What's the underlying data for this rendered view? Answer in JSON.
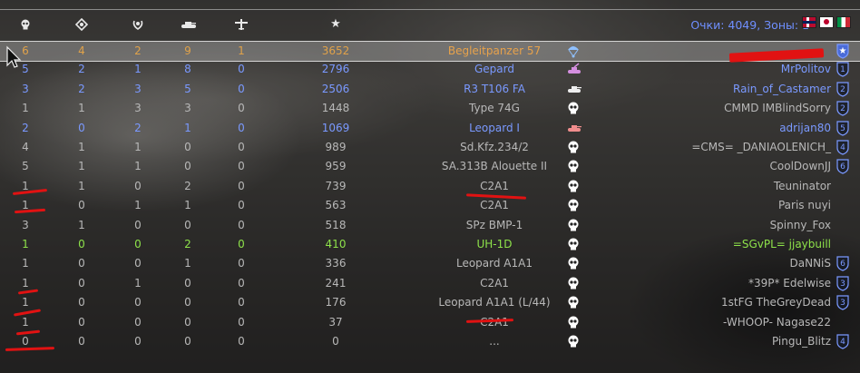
{
  "header": {
    "stats_text": "Очки: 4049, Зоны: 1",
    "column_icons": [
      "skull-icon",
      "target-icon",
      "assist-wreath-icon",
      "tank-icon",
      "plane-icon",
      "star-icon"
    ],
    "flags": [
      "norway-flag",
      "japan-flag",
      "italy-flag"
    ]
  },
  "colors": {
    "gold": "#e0a24a",
    "blue": "#7a99ff",
    "green": "#8ee24a",
    "grey": "#b8b8b8",
    "red_marker": "#e11212"
  },
  "rows": [
    {
      "c1": "6",
      "c2": "4",
      "c3": "2",
      "c4": "9",
      "c5": "1",
      "score": "3652",
      "vehicle": "Begleitpanzer 57",
      "vehicle_icon": "parachute-icon",
      "player": "",
      "squad": "star",
      "style": "gold",
      "highlight": true
    },
    {
      "c1": "5",
      "c2": "2",
      "c3": "1",
      "c4": "8",
      "c5": "0",
      "score": "2796",
      "vehicle": "Gepard",
      "vehicle_icon": "spaa-icon",
      "player": "MrPolitov",
      "squad": "1",
      "style": "blue"
    },
    {
      "c1": "3",
      "c2": "2",
      "c3": "3",
      "c4": "5",
      "c5": "0",
      "score": "2506",
      "vehicle": "R3 T106 FA",
      "vehicle_icon": "light-tank-icon",
      "player": "Rain_of_Castamer",
      "squad": "2",
      "style": "blue"
    },
    {
      "c1": "1",
      "c2": "1",
      "c3": "3",
      "c4": "3",
      "c5": "0",
      "score": "1448",
      "vehicle": "Type 74G",
      "vehicle_icon": "skull-icon",
      "player": "IMBlindSorry",
      "clan": "CMMD",
      "squad": "2",
      "style": "grey"
    },
    {
      "c1": "2",
      "c2": "0",
      "c3": "2",
      "c4": "1",
      "c5": "0",
      "score": "1069",
      "vehicle": "Leopard I",
      "vehicle_icon": "medium-tank-icon",
      "player": "adrijan80",
      "squad": "5",
      "style": "blue"
    },
    {
      "c1": "4",
      "c2": "1",
      "c3": "1",
      "c4": "0",
      "c5": "0",
      "score": "989",
      "vehicle": "Sd.Kfz.234/2",
      "vehicle_icon": "skull-icon",
      "player": "=CMS= _DANIAOLENICH_",
      "squad": "4",
      "style": "grey"
    },
    {
      "c1": "5",
      "c2": "1",
      "c3": "1",
      "c4": "0",
      "c5": "0",
      "score": "959",
      "vehicle": "SA.313B Alouette II",
      "vehicle_icon": "skull-icon",
      "player": "CoolDownJJ",
      "squad": "6",
      "style": "grey"
    },
    {
      "c1": "1",
      "c2": "1",
      "c3": "0",
      "c4": "2",
      "c5": "0",
      "score": "739",
      "vehicle": "C2A1",
      "vehicle_icon": "skull-icon",
      "player": "Teuninator",
      "squad": "",
      "style": "grey"
    },
    {
      "c1": "1",
      "c2": "0",
      "c3": "1",
      "c4": "1",
      "c5": "0",
      "score": "563",
      "vehicle": "C2A1",
      "vehicle_icon": "skull-icon",
      "player": "nuyi",
      "clan": "Paris",
      "squad": "",
      "style": "grey"
    },
    {
      "c1": "3",
      "c2": "1",
      "c3": "0",
      "c4": "0",
      "c5": "0",
      "score": "518",
      "vehicle": "SPz BMP-1",
      "vehicle_icon": "skull-icon",
      "player": "Spinny_Fox",
      "squad": "",
      "style": "grey"
    },
    {
      "c1": "1",
      "c2": "0",
      "c3": "0",
      "c4": "2",
      "c5": "0",
      "score": "410",
      "vehicle": "UH-1D",
      "vehicle_icon": "skull-icon",
      "player": "=SGvPL= jjaybuill",
      "squad": "",
      "style": "green"
    },
    {
      "c1": "1",
      "c2": "0",
      "c3": "0",
      "c4": "1",
      "c5": "0",
      "score": "336",
      "vehicle": "Leopard A1A1",
      "vehicle_icon": "skull-icon",
      "player": "DaNNiS",
      "squad": "6",
      "style": "grey"
    },
    {
      "c1": "1",
      "c2": "0",
      "c3": "1",
      "c4": "0",
      "c5": "0",
      "score": "241",
      "vehicle": "C2A1",
      "vehicle_icon": "skull-icon",
      "player": "*39P* Edelwise",
      "squad": "3",
      "style": "grey"
    },
    {
      "c1": "1",
      "c2": "0",
      "c3": "0",
      "c4": "0",
      "c5": "0",
      "score": "176",
      "vehicle": "Leopard A1A1 (L/44)",
      "vehicle_icon": "skull-icon",
      "player": "TheGreyDead",
      "clan": "1stFG",
      "squad": "3",
      "style": "grey"
    },
    {
      "c1": "1",
      "c2": "0",
      "c3": "0",
      "c4": "0",
      "c5": "0",
      "score": "37",
      "vehicle": "C2A1",
      "vehicle_icon": "skull-icon",
      "player": "-WHOOP- Nagase22",
      "squad": "",
      "style": "grey"
    },
    {
      "c1": "0",
      "c2": "0",
      "c3": "0",
      "c4": "0",
      "c5": "0",
      "score": "0",
      "vehicle": "...",
      "vehicle_icon": "skull-icon",
      "player": "Pingu_Blitz",
      "squad": "4",
      "style": "grey"
    }
  ]
}
